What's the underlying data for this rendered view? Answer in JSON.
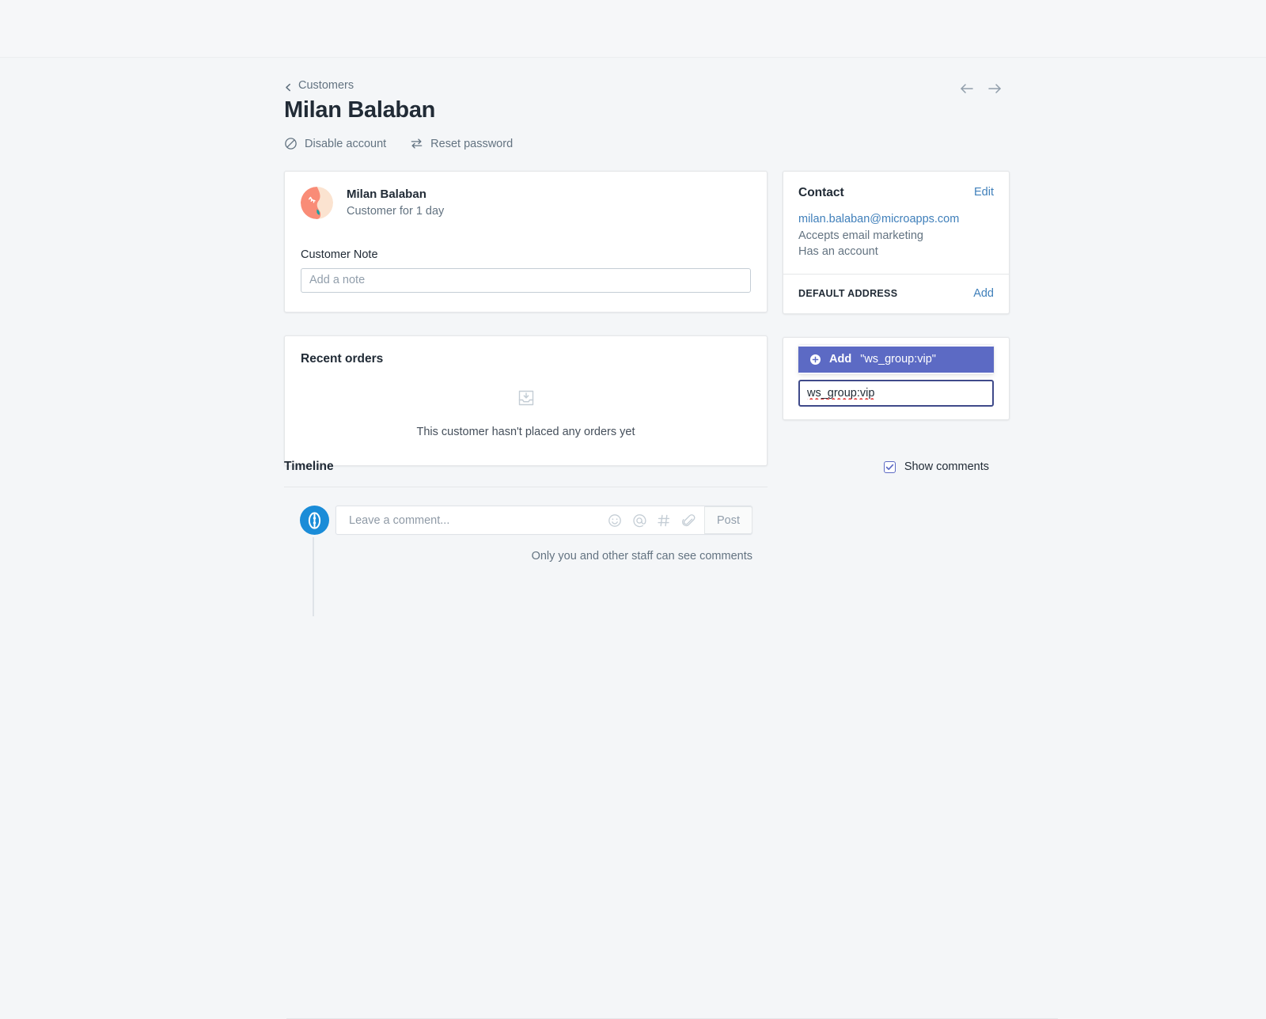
{
  "header": {
    "breadcrumb": "Customers",
    "title": "Milan Balaban",
    "actions": [
      {
        "label": "Disable account",
        "icon": "no-entry-icon"
      },
      {
        "label": "Reset password",
        "icon": "swap-arrows-icon"
      }
    ],
    "pager": {
      "prev_icon": "arrow-left-icon",
      "next_icon": "arrow-right-icon"
    }
  },
  "customer_card": {
    "name": "Milan Balaban",
    "subtitle": "Customer for 1 day",
    "note_label": "Customer Note",
    "note_value": "",
    "note_placeholder": "Add a note",
    "avatar_icon": "customer-avatar-face"
  },
  "recent_orders": {
    "title": "Recent orders",
    "empty_icon": "inbox-download-icon",
    "empty_message": "This customer hasn't placed any orders yet"
  },
  "contact": {
    "title": "Contact",
    "edit_label": "Edit",
    "email": "milan.balaban@microapps.com",
    "lines": [
      "Accepts email marketing",
      "Has an account"
    ],
    "default_address_label": "DEFAULT ADDRESS",
    "add_label": "Add"
  },
  "tags": {
    "option_prefix": "Add",
    "option_value": "\"ws_group:vip\"",
    "option_icon": "circle-plus-icon",
    "input_value": "ws_group:vip",
    "input_placeholder": ""
  },
  "timeline": {
    "title": "Timeline",
    "show_comments_label": "Show comments",
    "show_comments_checked": true,
    "comment_placeholder": "Leave a comment...",
    "comment_value": "",
    "post_label": "Post",
    "hint": "Only you and other staff can see comments",
    "tools": [
      {
        "icon": "emoji-icon"
      },
      {
        "icon": "mention-at-icon"
      },
      {
        "icon": "hashtag-icon"
      },
      {
        "icon": "paperclip-icon"
      }
    ],
    "staff_avatar_icon": "staff-avatar-icon"
  },
  "colors": {
    "page_background": "#f4f6f8",
    "card_background": "#ffffff",
    "text_primary": "#212b36",
    "text_secondary": "#637381",
    "link": "#3f7fba",
    "accent_purple": "#5c6ac4",
    "input_focus_border": "#3f4a8a",
    "avatar_blue": "#1a8cd8",
    "spellcheck_red": "#e02020"
  }
}
